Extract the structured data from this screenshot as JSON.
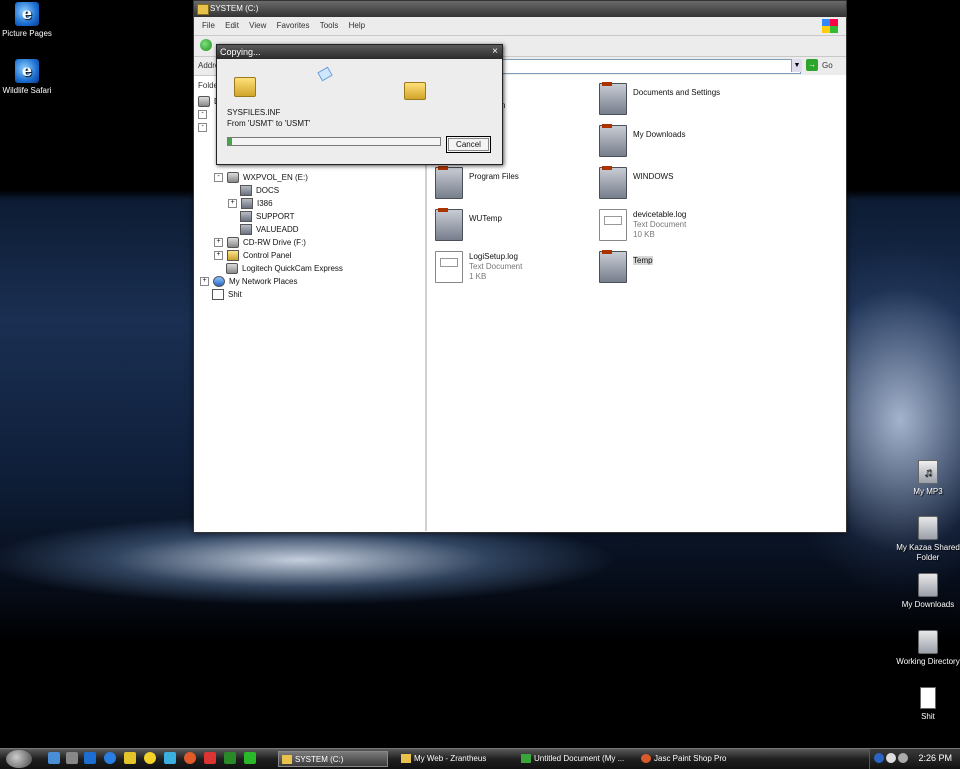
{
  "desktop": {
    "icons_left": [
      {
        "label": "Picture Pages",
        "icon": "ie-icon"
      },
      {
        "label": "Wildlife Safari",
        "icon": "ie-icon"
      }
    ],
    "icons_right": [
      {
        "label": "My MP3",
        "icon": "music-folder-icon"
      },
      {
        "label": "My Kazaa Shared Folder",
        "icon": "folder-icon"
      },
      {
        "label": "My Downloads",
        "icon": "folder-icon"
      },
      {
        "label": "Working Directory",
        "icon": "folder-icon"
      },
      {
        "label": "Shit",
        "icon": "document-icon"
      }
    ]
  },
  "explorer": {
    "title": "SYSTEM (C:)",
    "menu": [
      "File",
      "Edit",
      "View",
      "Favorites",
      "Tools",
      "Help"
    ],
    "address_label": "Addre",
    "go_label": "Go",
    "folders_label": "Folde",
    "tree": [
      {
        "label": "D",
        "expander": ""
      },
      {
        "label": "WXPVOL_EN (E:)",
        "expander": "-"
      },
      {
        "label": "DOCS",
        "expander": ""
      },
      {
        "label": "I386",
        "expander": "+"
      },
      {
        "label": "SUPPORT",
        "expander": ""
      },
      {
        "label": "VALUEADD",
        "expander": ""
      },
      {
        "label": "CD-RW Drive (F:)",
        "expander": "+"
      },
      {
        "label": "Control Panel",
        "expander": "+"
      },
      {
        "label": "Logitech QuickCam Express",
        "expander": ""
      },
      {
        "label": "My Network Places",
        "expander": "+"
      },
      {
        "label": "Shit",
        "expander": ""
      }
    ],
    "files": [
      {
        "name": "n",
        "type": "folder"
      },
      {
        "name": "Documents and Settings",
        "type": "folder"
      },
      {
        "name": "My Downloads",
        "type": "folder"
      },
      {
        "name": "Program Files",
        "type": "folder"
      },
      {
        "name": "WINDOWS",
        "type": "folder"
      },
      {
        "name": "WUTemp",
        "type": "folder"
      },
      {
        "name": "devicetable.log",
        "type": "text",
        "kind": "Text Document",
        "size": "10 KB"
      },
      {
        "name": "LogiSetup.log",
        "type": "text",
        "kind": "Text Document",
        "size": "1 KB"
      },
      {
        "name": "Temp",
        "type": "folder"
      }
    ]
  },
  "copy_dialog": {
    "title": "Copying...",
    "close_glyph": "×",
    "file": "SYSFILES.INF",
    "from_to": "From 'USMT' to 'USMT'",
    "progress_fraction": 0.02,
    "cancel_label": "Cancel"
  },
  "taskbar": {
    "tasks": [
      {
        "label": "SYSTEM (C:)",
        "active": true
      },
      {
        "label": "My Web - Zrantheus",
        "active": false
      },
      {
        "label": "Untitled Document (My ...",
        "active": false
      },
      {
        "label": "Jasc Paint Shop Pro",
        "active": false
      }
    ],
    "clock": "2:26 PM"
  }
}
